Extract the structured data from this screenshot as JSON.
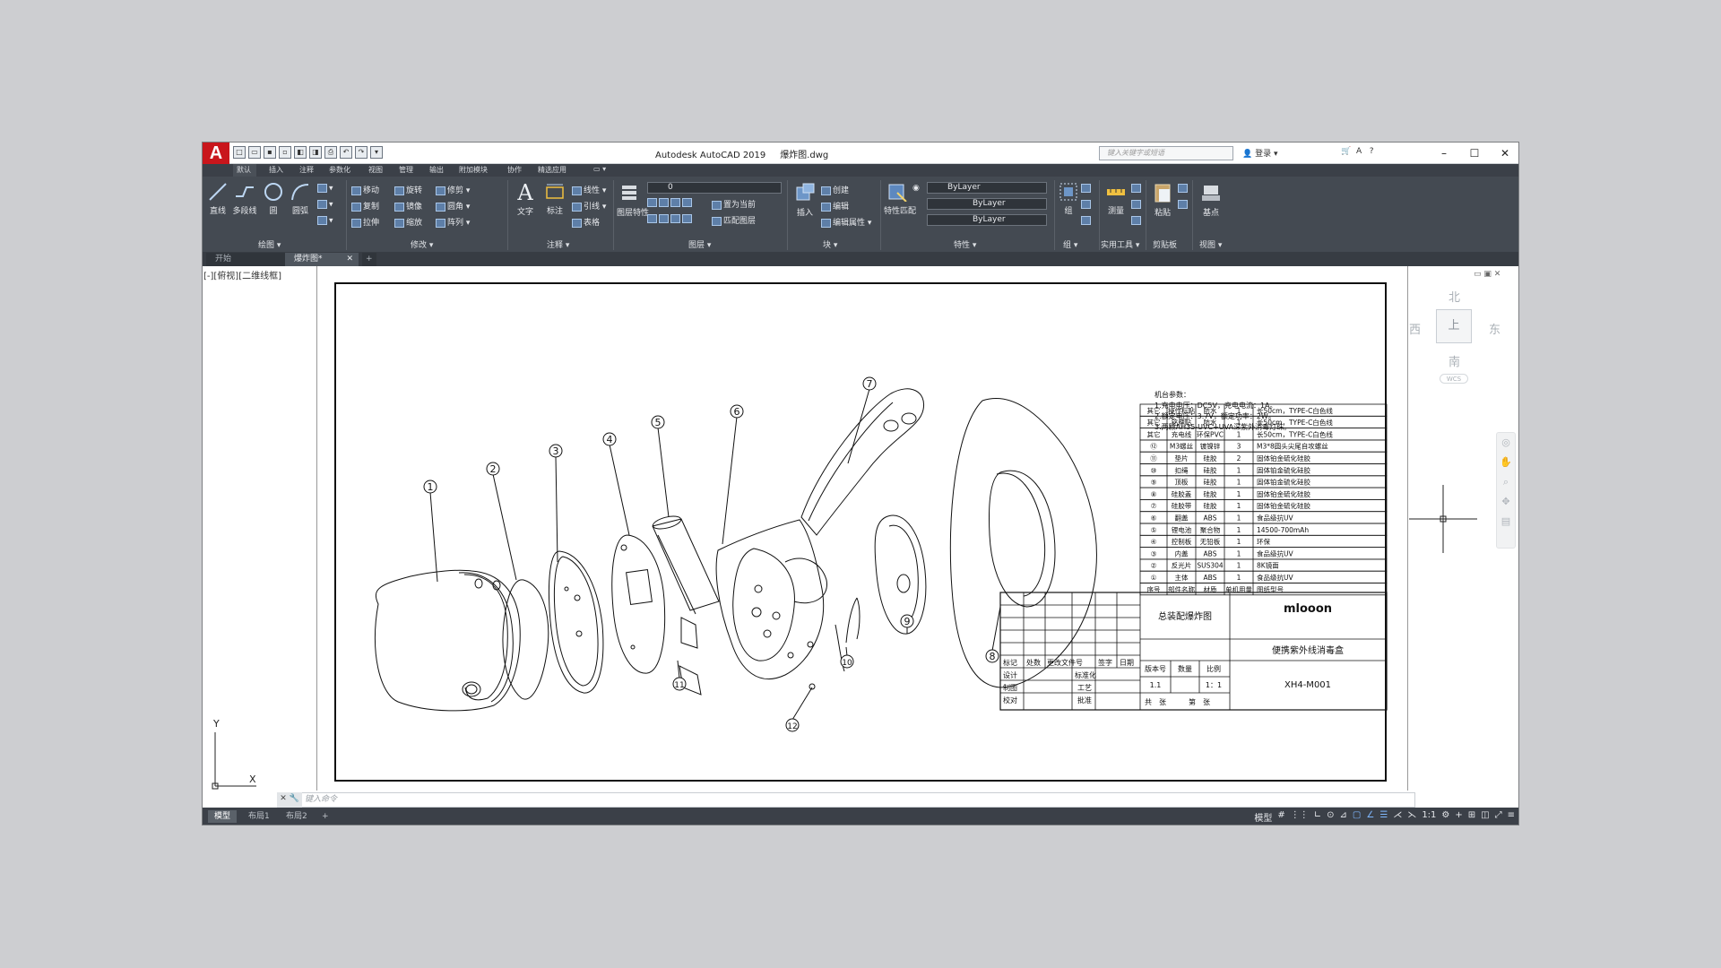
{
  "titlebar": {
    "logo": "A",
    "title": "Autodesk AutoCAD 2019",
    "filename": "爆炸图.dwg",
    "search_placeholder": "键入关键字或短语",
    "signin": "登录",
    "help": "?"
  },
  "menubar": {
    "items": [
      "默认",
      "插入",
      "注释",
      "参数化",
      "视图",
      "管理",
      "输出",
      "附加模块",
      "协作",
      "精选应用"
    ]
  },
  "ribbon": {
    "draw": {
      "line": "直线",
      "polyline": "多段线",
      "circle": "圆",
      "arc": "圆弧",
      "label": "绘图 ▾"
    },
    "modify": {
      "move": "移动",
      "rotate": "旋转",
      "trim": "修剪",
      "copy": "复制",
      "mirror": "镜像",
      "fillet": "圆角",
      "stretch": "拉伸",
      "scale": "缩放",
      "array": "阵列",
      "label": "修改 ▾"
    },
    "annotation": {
      "text": "文字",
      "dimension": "标注",
      "linear": "线性",
      "leader": "引线",
      "table": "表格",
      "label": "注释 ▾"
    },
    "layers": {
      "properties": "图层特性",
      "current_layer": "0",
      "make_current": "置为当前",
      "match_layer": "匹配图层",
      "label": "图层 ▾"
    },
    "block": {
      "insert": "插入",
      "create": "创建",
      "edit": "编辑",
      "edit_attributes": "编辑属性",
      "label": "块 ▾"
    },
    "properties": {
      "match": "特性匹配",
      "color": "ByLayer",
      "linetype": "ByLayer",
      "lineweight": "ByLayer",
      "label": "特性 ▾"
    },
    "groups": {
      "group": "组",
      "label": "组 ▾"
    },
    "utilities": {
      "measure": "测量",
      "label": "实用工具 ▾"
    },
    "clipboard": {
      "paste": "粘贴",
      "label": "剪贴板"
    },
    "view": {
      "base": "基点",
      "label": "视图 ▾"
    }
  },
  "doctabs": {
    "start": "开始",
    "active": "爆炸图*",
    "plus": "+"
  },
  "canvas": {
    "view_label": "[-][俯视][二维线框]",
    "viewcube": {
      "north": "北",
      "south": "南",
      "east": "东",
      "west": "西",
      "top": "上",
      "wcs": "WCS"
    }
  },
  "drawing": {
    "callouts": [
      "1",
      "2",
      "3",
      "4",
      "5",
      "6",
      "7",
      "8",
      "9",
      "10",
      "11",
      "12"
    ],
    "params_title": "机台参数：",
    "params": [
      "1.充电电压：DC5V，充电电流：1A。",
      "2.额定电压：3.7V，额定功率：2W。",
      "3.两颗AH35-UVC+UVA深紫外消毒灯珠。"
    ],
    "bom": [
      [
        "其它",
        "操作标贴",
        "防水",
        "1",
        "长50cm，TYPE-C白色线"
      ],
      [
        "其它",
        "铭牌贴",
        "防水",
        "1",
        "长50cm，TYPE-C白色线"
      ],
      [
        "其它",
        "充电线",
        "环保PVC",
        "1",
        "长50cm，TYPE-C白色线"
      ],
      [
        "⑫",
        "M3螺丝",
        "镀镍锌",
        "3",
        "M3*8圆头尖尾自攻螺丝"
      ],
      [
        "⑪",
        "垫片",
        "硅胶",
        "2",
        "固体铂金硫化硅胶"
      ],
      [
        "⑩",
        "扣绳",
        "硅胶",
        "1",
        "固体铂金硫化硅胶"
      ],
      [
        "⑨",
        "顶板",
        "硅胶",
        "1",
        "固体铂金硫化硅胶"
      ],
      [
        "⑧",
        "硅胶盖",
        "硅胶",
        "1",
        "固体铂金硫化硅胶"
      ],
      [
        "⑦",
        "硅胶带",
        "硅胶",
        "1",
        "固体铂金硫化硅胶"
      ],
      [
        "⑥",
        "翻盖",
        "ABS",
        "1",
        "食品级抗UV"
      ],
      [
        "⑤",
        "锂电池",
        "聚合物",
        "1",
        "14500-700mAh"
      ],
      [
        "④",
        "控制板",
        "无铅板",
        "1",
        "环保"
      ],
      [
        "③",
        "内盖",
        "ABS",
        "1",
        "食品级抗UV"
      ],
      [
        "②",
        "反光片",
        "SUS304",
        "1",
        "8K镜面"
      ],
      [
        "①",
        "主体",
        "ABS",
        "1",
        "食品级抗UV"
      ]
    ],
    "bom_header": [
      "序号",
      "部件名称",
      "材质",
      "单机用量",
      "图纸型号"
    ],
    "title_block": {
      "drawing_title": "总装配爆炸图",
      "company": "mlooon",
      "product": "便携紫外线消毒盒",
      "code": "XH4-M001",
      "version_label": "版本号",
      "quantity_label": "数量",
      "scale_label": "比例",
      "version": "1.1",
      "scale": "1：1",
      "sheets": "共　张",
      "sheet_no": "第　张",
      "rev_headers": [
        "标记",
        "处数",
        "更改文件号",
        "签字",
        "日期"
      ],
      "design": "设计",
      "standard": "标准化",
      "drafting": "制图",
      "process": "工艺",
      "check": "校对",
      "approve": "批准"
    }
  },
  "commandline": {
    "placeholder": "键入命令"
  },
  "statusbar": {
    "tabs": [
      "模型",
      "布局1",
      "布局2",
      "+"
    ],
    "model": "模型",
    "scale": "1:1"
  }
}
